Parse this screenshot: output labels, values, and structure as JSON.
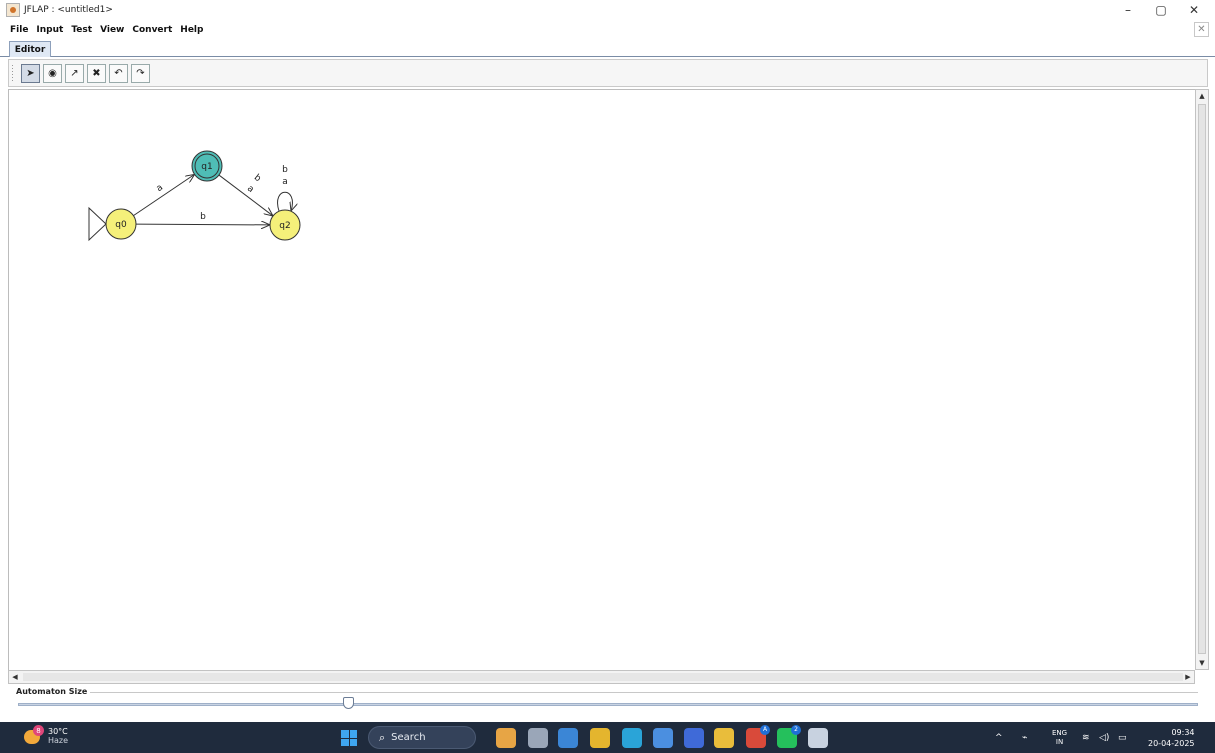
{
  "window": {
    "title": "JFLAP : <untitled1>",
    "min": "–",
    "restore": "▢",
    "close": "✕"
  },
  "menu": [
    "File",
    "Input",
    "Test",
    "View",
    "Convert",
    "Help"
  ],
  "inner_close": "✕",
  "tabs": [
    {
      "label": "Editor"
    }
  ],
  "toolbar": {
    "tools": [
      {
        "name": "attribute-editor",
        "glyph": "➤"
      },
      {
        "name": "state-creator",
        "glyph": "◉"
      },
      {
        "name": "transition-creator",
        "glyph": "↗"
      },
      {
        "name": "deleter",
        "glyph": "✖"
      },
      {
        "name": "undo",
        "glyph": "↶"
      },
      {
        "name": "redo",
        "glyph": "↷"
      }
    ]
  },
  "automaton": {
    "states": [
      {
        "id": "q0",
        "label": "q0",
        "initial": true,
        "final": false
      },
      {
        "id": "q1",
        "label": "q1",
        "initial": false,
        "final": true
      },
      {
        "id": "q2",
        "label": "q2",
        "initial": false,
        "final": false
      }
    ],
    "transitions": [
      {
        "from": "q0",
        "to": "q1",
        "label": "a"
      },
      {
        "from": "q0",
        "to": "q2",
        "label": "b"
      },
      {
        "from": "q1",
        "to": "q2",
        "label": "a"
      },
      {
        "from": "q1",
        "to": "q2",
        "label": "b"
      },
      {
        "from": "q2",
        "to": "q2",
        "label": "a"
      },
      {
        "from": "q2",
        "to": "q2",
        "label": "b"
      }
    ],
    "colors": {
      "state": "#f5f07a",
      "selected_state": "#4fbdb6",
      "stroke": "#333333"
    }
  },
  "size_panel": {
    "label": "Automaton Size",
    "value": 0.28
  },
  "taskbar": {
    "weather": {
      "temp": "30°C",
      "condition": "Haze",
      "badge": "8"
    },
    "search": "Search",
    "tray": {
      "lang_top": "ENG",
      "lang_bottom": "IN",
      "time": "09:34",
      "date": "20-04-2025",
      "chevron": "^"
    },
    "apps": [
      {
        "name": "bucket-app-icon",
        "color": "#e7a545"
      },
      {
        "name": "taskview-icon",
        "color": "#9aa6b8"
      },
      {
        "name": "copilot-icon",
        "color": "#3b86d6"
      },
      {
        "name": "chrome-icon",
        "color": "#e4b52e"
      },
      {
        "name": "edge-icon",
        "color": "#2aa4d8"
      },
      {
        "name": "store-icon",
        "color": "#4b8fe0"
      },
      {
        "name": "lens-icon",
        "color": "#3f6ad8"
      },
      {
        "name": "explorer-icon",
        "color": "#e9bd3b"
      },
      {
        "name": "chrome-profile-icon",
        "color": "#d94a3a",
        "badge": "A"
      },
      {
        "name": "whatsapp-icon",
        "color": "#25c05c",
        "badge": "2"
      },
      {
        "name": "java-app-icon",
        "color": "#c8d2e0"
      }
    ]
  }
}
